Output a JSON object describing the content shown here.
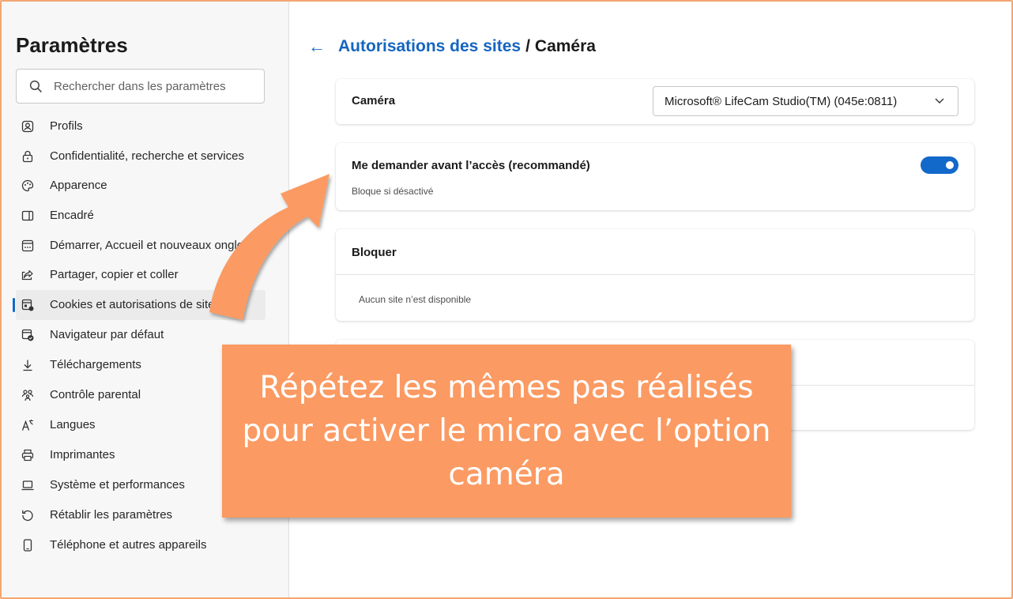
{
  "sidebar": {
    "title": "Paramètres",
    "search_placeholder": "Rechercher dans les paramètres",
    "items": [
      {
        "label": "Profils",
        "icon": "profile-icon"
      },
      {
        "label": "Confidentialité, recherche et services",
        "icon": "lock-icon"
      },
      {
        "label": "Apparence",
        "icon": "palette-icon"
      },
      {
        "label": "Encadré",
        "icon": "sidebar-icon"
      },
      {
        "label": "Démarrer, Accueil et nouveaux onglets",
        "icon": "start-page-icon"
      },
      {
        "label": "Partager, copier et coller",
        "icon": "share-icon"
      },
      {
        "label": "Cookies et autorisations de site",
        "icon": "cookies-icon",
        "active": true
      },
      {
        "label": "Navigateur par défaut",
        "icon": "default-browser-icon"
      },
      {
        "label": "Téléchargements",
        "icon": "download-icon"
      },
      {
        "label": "Contrôle parental",
        "icon": "family-icon"
      },
      {
        "label": "Langues",
        "icon": "languages-icon"
      },
      {
        "label": "Imprimantes",
        "icon": "printer-icon"
      },
      {
        "label": "Système et performances",
        "icon": "laptop-icon"
      },
      {
        "label": "Rétablir les paramètres",
        "icon": "reset-icon"
      },
      {
        "label": "Téléphone et autres appareils",
        "icon": "phone-icon"
      }
    ]
  },
  "breadcrumb": {
    "parent": "Autorisations des sites",
    "separator": "/",
    "current": "Caméra"
  },
  "camera": {
    "label": "Caméra",
    "selected": "Microsoft® LifeCam Studio(TM) (045e:0811)"
  },
  "ask": {
    "label": "Me demander avant l’accès (recommandé)",
    "sub": "Bloque si désactivé",
    "enabled": true
  },
  "block": {
    "title": "Bloquer",
    "empty": "Aucun site n’est disponible"
  },
  "callout": {
    "text": "Répétez les mêmes pas réalisés pour activer le micro avec l’option caméra"
  },
  "colors": {
    "accent": "#1369c9",
    "callout": "#fb9a62",
    "frame": "#f4a672"
  }
}
